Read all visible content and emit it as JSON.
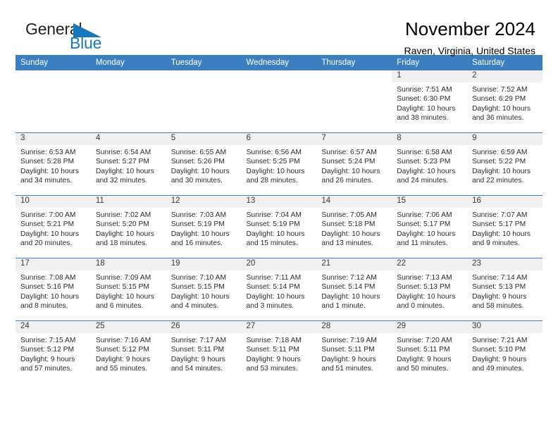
{
  "brand": {
    "name_part1": "General",
    "name_part2": "Blue",
    "flag_color": "#1878be",
    "text_color": "#231f20"
  },
  "header": {
    "title": "November 2024",
    "location": "Raven, Virginia, United States"
  },
  "theme": {
    "header_blue": "#3b7fc0",
    "daynum_band": "#f0f0f0",
    "text": "#2b2b2b"
  },
  "weekday_headers": [
    "Sunday",
    "Monday",
    "Tuesday",
    "Wednesday",
    "Thursday",
    "Friday",
    "Saturday"
  ],
  "weeks": [
    [
      {
        "day": "",
        "empty": true,
        "sunrise": "",
        "sunset": "",
        "daylight1": "",
        "daylight2": ""
      },
      {
        "day": "",
        "empty": true,
        "sunrise": "",
        "sunset": "",
        "daylight1": "",
        "daylight2": ""
      },
      {
        "day": "",
        "empty": true,
        "sunrise": "",
        "sunset": "",
        "daylight1": "",
        "daylight2": ""
      },
      {
        "day": "",
        "empty": true,
        "sunrise": "",
        "sunset": "",
        "daylight1": "",
        "daylight2": ""
      },
      {
        "day": "",
        "empty": true,
        "sunrise": "",
        "sunset": "",
        "daylight1": "",
        "daylight2": ""
      },
      {
        "day": "1",
        "empty": false,
        "sunrise": "Sunrise: 7:51 AM",
        "sunset": "Sunset: 6:30 PM",
        "daylight1": "Daylight: 10 hours",
        "daylight2": "and 38 minutes."
      },
      {
        "day": "2",
        "empty": false,
        "sunrise": "Sunrise: 7:52 AM",
        "sunset": "Sunset: 6:29 PM",
        "daylight1": "Daylight: 10 hours",
        "daylight2": "and 36 minutes."
      }
    ],
    [
      {
        "day": "3",
        "empty": false,
        "sunrise": "Sunrise: 6:53 AM",
        "sunset": "Sunset: 5:28 PM",
        "daylight1": "Daylight: 10 hours",
        "daylight2": "and 34 minutes."
      },
      {
        "day": "4",
        "empty": false,
        "sunrise": "Sunrise: 6:54 AM",
        "sunset": "Sunset: 5:27 PM",
        "daylight1": "Daylight: 10 hours",
        "daylight2": "and 32 minutes."
      },
      {
        "day": "5",
        "empty": false,
        "sunrise": "Sunrise: 6:55 AM",
        "sunset": "Sunset: 5:26 PM",
        "daylight1": "Daylight: 10 hours",
        "daylight2": "and 30 minutes."
      },
      {
        "day": "6",
        "empty": false,
        "sunrise": "Sunrise: 6:56 AM",
        "sunset": "Sunset: 5:25 PM",
        "daylight1": "Daylight: 10 hours",
        "daylight2": "and 28 minutes."
      },
      {
        "day": "7",
        "empty": false,
        "sunrise": "Sunrise: 6:57 AM",
        "sunset": "Sunset: 5:24 PM",
        "daylight1": "Daylight: 10 hours",
        "daylight2": "and 26 minutes."
      },
      {
        "day": "8",
        "empty": false,
        "sunrise": "Sunrise: 6:58 AM",
        "sunset": "Sunset: 5:23 PM",
        "daylight1": "Daylight: 10 hours",
        "daylight2": "and 24 minutes."
      },
      {
        "day": "9",
        "empty": false,
        "sunrise": "Sunrise: 6:59 AM",
        "sunset": "Sunset: 5:22 PM",
        "daylight1": "Daylight: 10 hours",
        "daylight2": "and 22 minutes."
      }
    ],
    [
      {
        "day": "10",
        "empty": false,
        "sunrise": "Sunrise: 7:00 AM",
        "sunset": "Sunset: 5:21 PM",
        "daylight1": "Daylight: 10 hours",
        "daylight2": "and 20 minutes."
      },
      {
        "day": "11",
        "empty": false,
        "sunrise": "Sunrise: 7:02 AM",
        "sunset": "Sunset: 5:20 PM",
        "daylight1": "Daylight: 10 hours",
        "daylight2": "and 18 minutes."
      },
      {
        "day": "12",
        "empty": false,
        "sunrise": "Sunrise: 7:03 AM",
        "sunset": "Sunset: 5:19 PM",
        "daylight1": "Daylight: 10 hours",
        "daylight2": "and 16 minutes."
      },
      {
        "day": "13",
        "empty": false,
        "sunrise": "Sunrise: 7:04 AM",
        "sunset": "Sunset: 5:19 PM",
        "daylight1": "Daylight: 10 hours",
        "daylight2": "and 15 minutes."
      },
      {
        "day": "14",
        "empty": false,
        "sunrise": "Sunrise: 7:05 AM",
        "sunset": "Sunset: 5:18 PM",
        "daylight1": "Daylight: 10 hours",
        "daylight2": "and 13 minutes."
      },
      {
        "day": "15",
        "empty": false,
        "sunrise": "Sunrise: 7:06 AM",
        "sunset": "Sunset: 5:17 PM",
        "daylight1": "Daylight: 10 hours",
        "daylight2": "and 11 minutes."
      },
      {
        "day": "16",
        "empty": false,
        "sunrise": "Sunrise: 7:07 AM",
        "sunset": "Sunset: 5:17 PM",
        "daylight1": "Daylight: 10 hours",
        "daylight2": "and 9 minutes."
      }
    ],
    [
      {
        "day": "17",
        "empty": false,
        "sunrise": "Sunrise: 7:08 AM",
        "sunset": "Sunset: 5:16 PM",
        "daylight1": "Daylight: 10 hours",
        "daylight2": "and 8 minutes."
      },
      {
        "day": "18",
        "empty": false,
        "sunrise": "Sunrise: 7:09 AM",
        "sunset": "Sunset: 5:15 PM",
        "daylight1": "Daylight: 10 hours",
        "daylight2": "and 6 minutes."
      },
      {
        "day": "19",
        "empty": false,
        "sunrise": "Sunrise: 7:10 AM",
        "sunset": "Sunset: 5:15 PM",
        "daylight1": "Daylight: 10 hours",
        "daylight2": "and 4 minutes."
      },
      {
        "day": "20",
        "empty": false,
        "sunrise": "Sunrise: 7:11 AM",
        "sunset": "Sunset: 5:14 PM",
        "daylight1": "Daylight: 10 hours",
        "daylight2": "and 3 minutes."
      },
      {
        "day": "21",
        "empty": false,
        "sunrise": "Sunrise: 7:12 AM",
        "sunset": "Sunset: 5:14 PM",
        "daylight1": "Daylight: 10 hours",
        "daylight2": "and 1 minute."
      },
      {
        "day": "22",
        "empty": false,
        "sunrise": "Sunrise: 7:13 AM",
        "sunset": "Sunset: 5:13 PM",
        "daylight1": "Daylight: 10 hours",
        "daylight2": "and 0 minutes."
      },
      {
        "day": "23",
        "empty": false,
        "sunrise": "Sunrise: 7:14 AM",
        "sunset": "Sunset: 5:13 PM",
        "daylight1": "Daylight: 9 hours",
        "daylight2": "and 58 minutes."
      }
    ],
    [
      {
        "day": "24",
        "empty": false,
        "sunrise": "Sunrise: 7:15 AM",
        "sunset": "Sunset: 5:12 PM",
        "daylight1": "Daylight: 9 hours",
        "daylight2": "and 57 minutes."
      },
      {
        "day": "25",
        "empty": false,
        "sunrise": "Sunrise: 7:16 AM",
        "sunset": "Sunset: 5:12 PM",
        "daylight1": "Daylight: 9 hours",
        "daylight2": "and 55 minutes."
      },
      {
        "day": "26",
        "empty": false,
        "sunrise": "Sunrise: 7:17 AM",
        "sunset": "Sunset: 5:11 PM",
        "daylight1": "Daylight: 9 hours",
        "daylight2": "and 54 minutes."
      },
      {
        "day": "27",
        "empty": false,
        "sunrise": "Sunrise: 7:18 AM",
        "sunset": "Sunset: 5:11 PM",
        "daylight1": "Daylight: 9 hours",
        "daylight2": "and 53 minutes."
      },
      {
        "day": "28",
        "empty": false,
        "sunrise": "Sunrise: 7:19 AM",
        "sunset": "Sunset: 5:11 PM",
        "daylight1": "Daylight: 9 hours",
        "daylight2": "and 51 minutes."
      },
      {
        "day": "29",
        "empty": false,
        "sunrise": "Sunrise: 7:20 AM",
        "sunset": "Sunset: 5:11 PM",
        "daylight1": "Daylight: 9 hours",
        "daylight2": "and 50 minutes."
      },
      {
        "day": "30",
        "empty": false,
        "sunrise": "Sunrise: 7:21 AM",
        "sunset": "Sunset: 5:10 PM",
        "daylight1": "Daylight: 9 hours",
        "daylight2": "and 49 minutes."
      }
    ]
  ]
}
